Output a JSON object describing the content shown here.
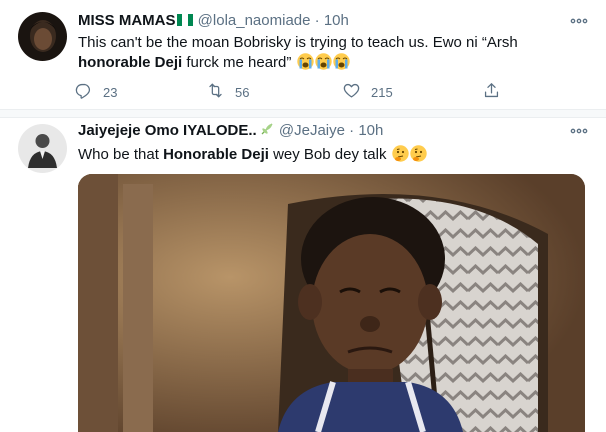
{
  "tweets": [
    {
      "display_name": "MISS MAMAS",
      "name_flag": "nigeria-flag",
      "handle": "@lola_naomiade",
      "separator": "·",
      "time": "10h",
      "more_label": "ooo",
      "text_line1": "This can't be the moan Bobrisky is trying to teach us. Ewo ni “Arsh",
      "text_line2_bold": "honorable Deji",
      "text_line2_rest": " furck me heard”",
      "emojis": [
        "loudly-crying-face",
        "loudly-crying-face",
        "loudly-crying-face"
      ],
      "reply_count": "23",
      "retweet_count": "56",
      "like_count": "215"
    },
    {
      "display_name": "Jaiyejeje Omo IYALODE..",
      "name_icon": "leaf-emoji",
      "handle": "@JeJaiye",
      "separator": "·",
      "time": "10h",
      "more_label": "ooo",
      "text_pre": "Who be that ",
      "text_bold": "Honorable Deji",
      "text_post": " wey Bob dey talk ",
      "emojis": [
        "thinking-face",
        "thinking-face"
      ],
      "media": "photo-of-boy-crying"
    }
  ],
  "colors": {
    "text": "#0f1419",
    "secondary": "#5b7083",
    "divider": "#ebeef0",
    "gap": "#f7f9fa"
  }
}
